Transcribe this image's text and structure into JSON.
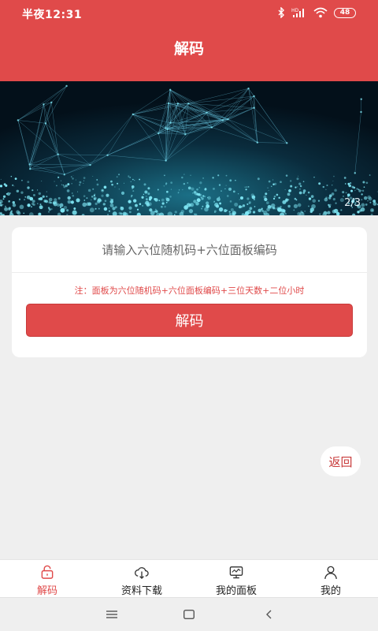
{
  "status_bar": {
    "time": "半夜12:31",
    "battery": "48"
  },
  "header": {
    "title": "解码"
  },
  "banner": {
    "counter": "2/3"
  },
  "decode_card": {
    "input_placeholder": "请输入六位随机码+六位面板编码",
    "note": "注：面板为六位随机码+六位面板编码+三位天数+二位小时",
    "decode_label": "解码"
  },
  "back_button": {
    "label": "返回"
  },
  "tab_bar": {
    "active_color": "#e04a4a",
    "items": [
      {
        "label": "解码",
        "icon": "lock-icon",
        "active": true
      },
      {
        "label": "资料下载",
        "icon": "cloud-download-icon",
        "active": false
      },
      {
        "label": "我的面板",
        "icon": "monitor-icon",
        "active": false
      },
      {
        "label": "我的",
        "icon": "user-icon",
        "active": false
      }
    ]
  },
  "system_nav": {
    "items": [
      "menu-icon",
      "home-icon",
      "back-icon"
    ]
  },
  "colors": {
    "primary": "#e04a4a",
    "background": "#efefef",
    "card": "#ffffff"
  }
}
